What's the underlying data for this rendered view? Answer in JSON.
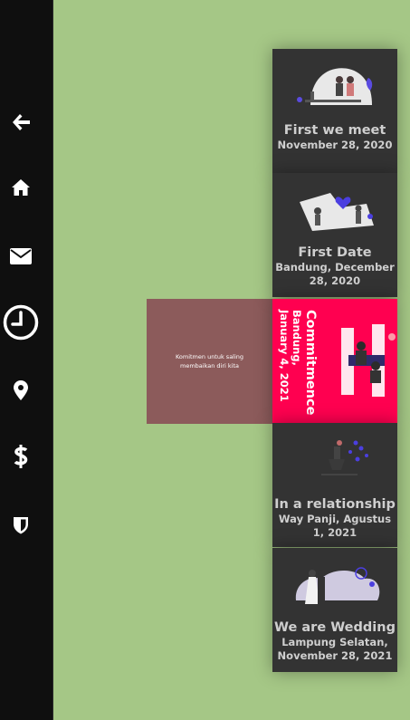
{
  "sidebar": {
    "items": [
      {
        "name": "back",
        "icon": "arrow-left-icon"
      },
      {
        "name": "home",
        "icon": "home-icon"
      },
      {
        "name": "mail",
        "icon": "envelope-icon"
      },
      {
        "name": "timeline",
        "icon": "clock-icon",
        "active": true
      },
      {
        "name": "location",
        "icon": "map-marker-icon"
      },
      {
        "name": "gift",
        "icon": "dollar-icon"
      },
      {
        "name": "protocol",
        "icon": "shield-icon"
      }
    ]
  },
  "timeline": {
    "events": [
      {
        "title": "First we meet",
        "subtitle": "November 28, 2020",
        "illustration": "couple-on-bench-icon"
      },
      {
        "title": "First Date",
        "subtitle": "Bandung, December 28, 2020",
        "illustration": "couple-with-hearts-icon"
      },
      {
        "title": "Commitmence",
        "subtitle": "Bandung, January 4, 2021",
        "illustration": "couple-at-table-icon",
        "active": true
      },
      {
        "title": "In a relationship",
        "subtitle": "Way Panji, Agustus 1, 2021",
        "illustration": "couple-with-balloons-icon"
      },
      {
        "title": "We are Wedding",
        "subtitle": "Lampung Selatan, November 28, 2021",
        "illustration": "wedding-couple-icon"
      }
    ],
    "active_description": "Komitmen untuk saling membaikan diri kita"
  },
  "colors": {
    "background": "#a5c786",
    "sidebar": "#0f0f0f",
    "card": "#333333",
    "active_card": "#ff0050",
    "description_panel": "#8c5b5b"
  }
}
